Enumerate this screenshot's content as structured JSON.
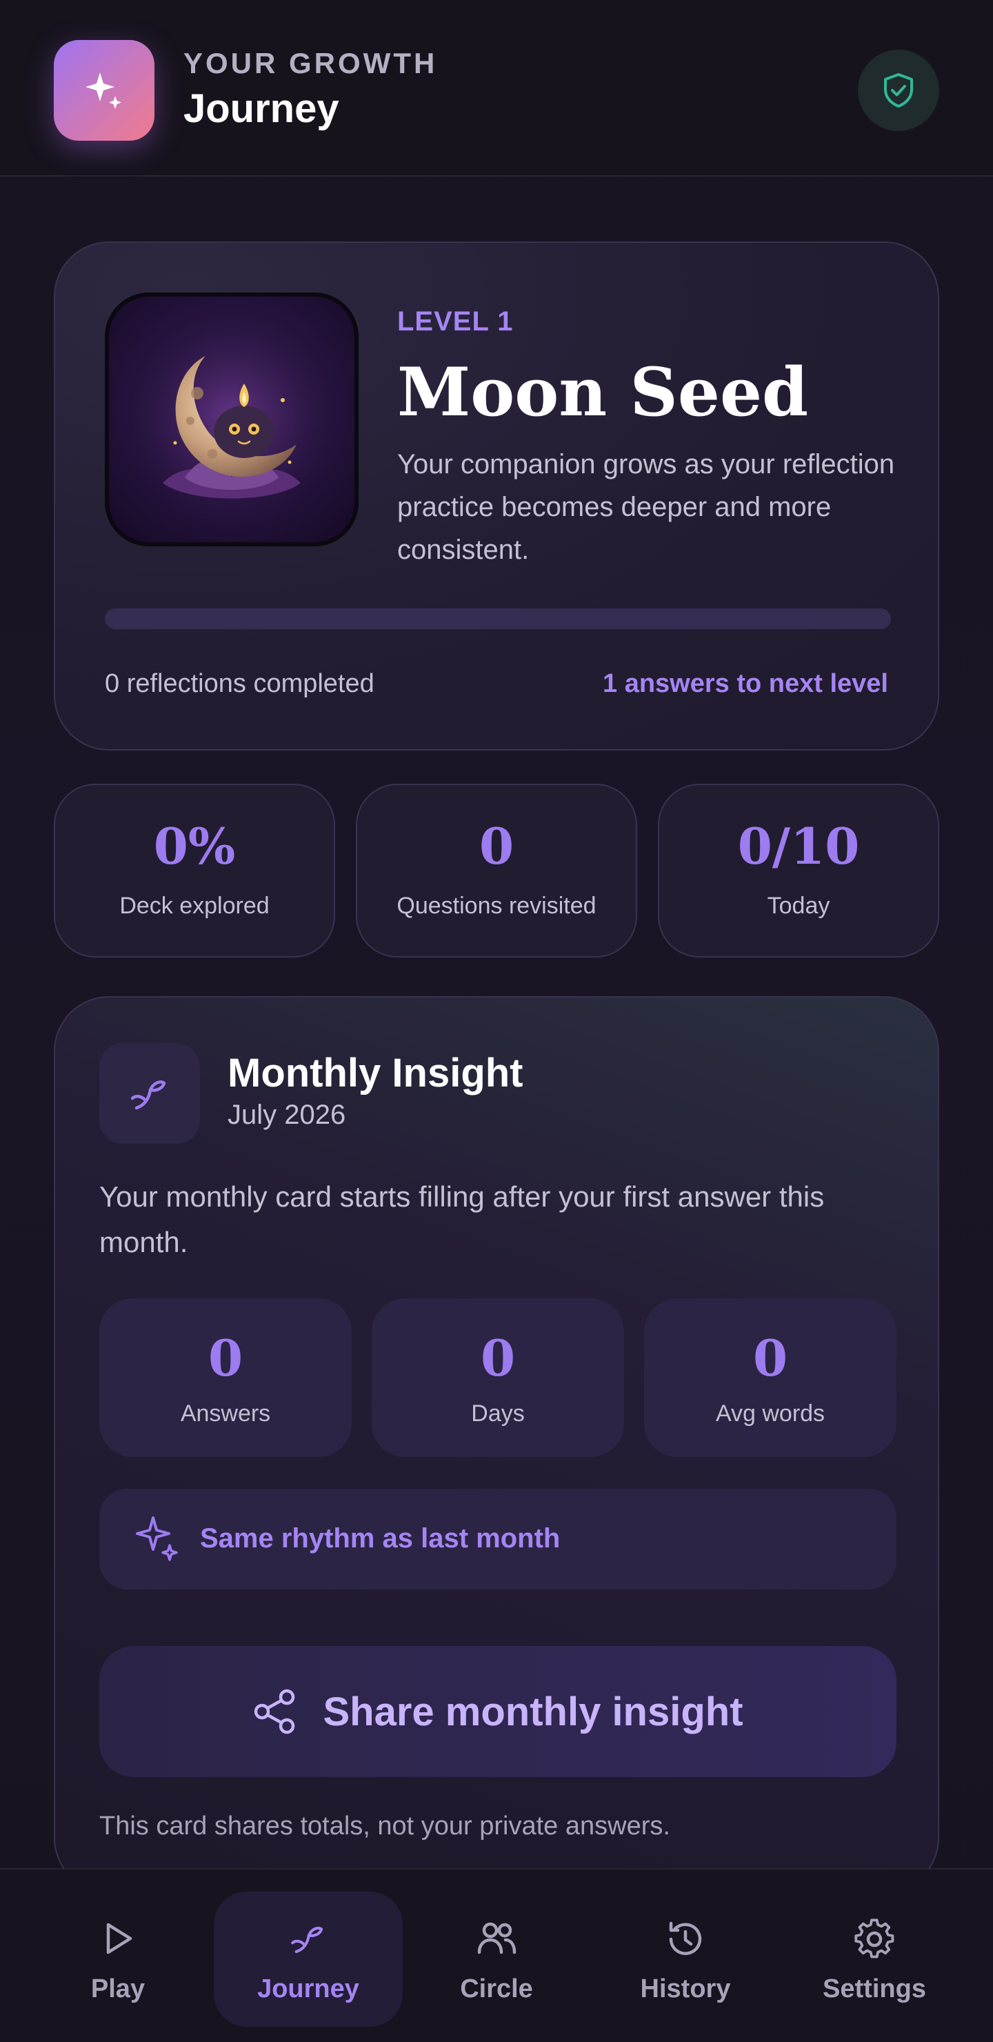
{
  "header": {
    "eyebrow": "YOUR GROWTH",
    "title": "Journey",
    "logo_icon": "sparkles-icon",
    "status_icon": "shield-check-icon"
  },
  "companion": {
    "level": "LEVEL 1",
    "name": "Moon Seed",
    "description": "Your companion grows as your reflection practice becomes deeper and more consistent.",
    "progress_fraction": 0,
    "reflections": "0 reflections completed",
    "to_next_level": "1 answers to next level"
  },
  "stats": [
    {
      "value": "0%",
      "label": "Deck explored"
    },
    {
      "value": "0",
      "label": "Questions revisited"
    },
    {
      "value": "0/10",
      "label": "Today"
    }
  ],
  "insight": {
    "icon": "sprout-icon",
    "title": "Monthly Insight",
    "date": "July 2026",
    "description": "Your monthly card starts filling after your first answer this month.",
    "metrics": [
      {
        "value": "0",
        "label": "Answers"
      },
      {
        "value": "0",
        "label": "Days"
      },
      {
        "value": "0",
        "label": "Avg words"
      }
    ],
    "rhythm": "Same rhythm as last month",
    "share_label": "Share monthly insight",
    "footnote": "This card shares totals, not your private answers."
  },
  "nav": {
    "active": "Journey",
    "items": [
      {
        "label": "Play",
        "icon": "play-icon"
      },
      {
        "label": "Journey",
        "icon": "sprout-icon"
      },
      {
        "label": "Circle",
        "icon": "users-icon"
      },
      {
        "label": "History",
        "icon": "history-icon"
      },
      {
        "label": "Settings",
        "icon": "gear-icon"
      }
    ]
  },
  "colors": {
    "accent": "#a585f3",
    "background": "#16121f",
    "card": "#221c30"
  }
}
